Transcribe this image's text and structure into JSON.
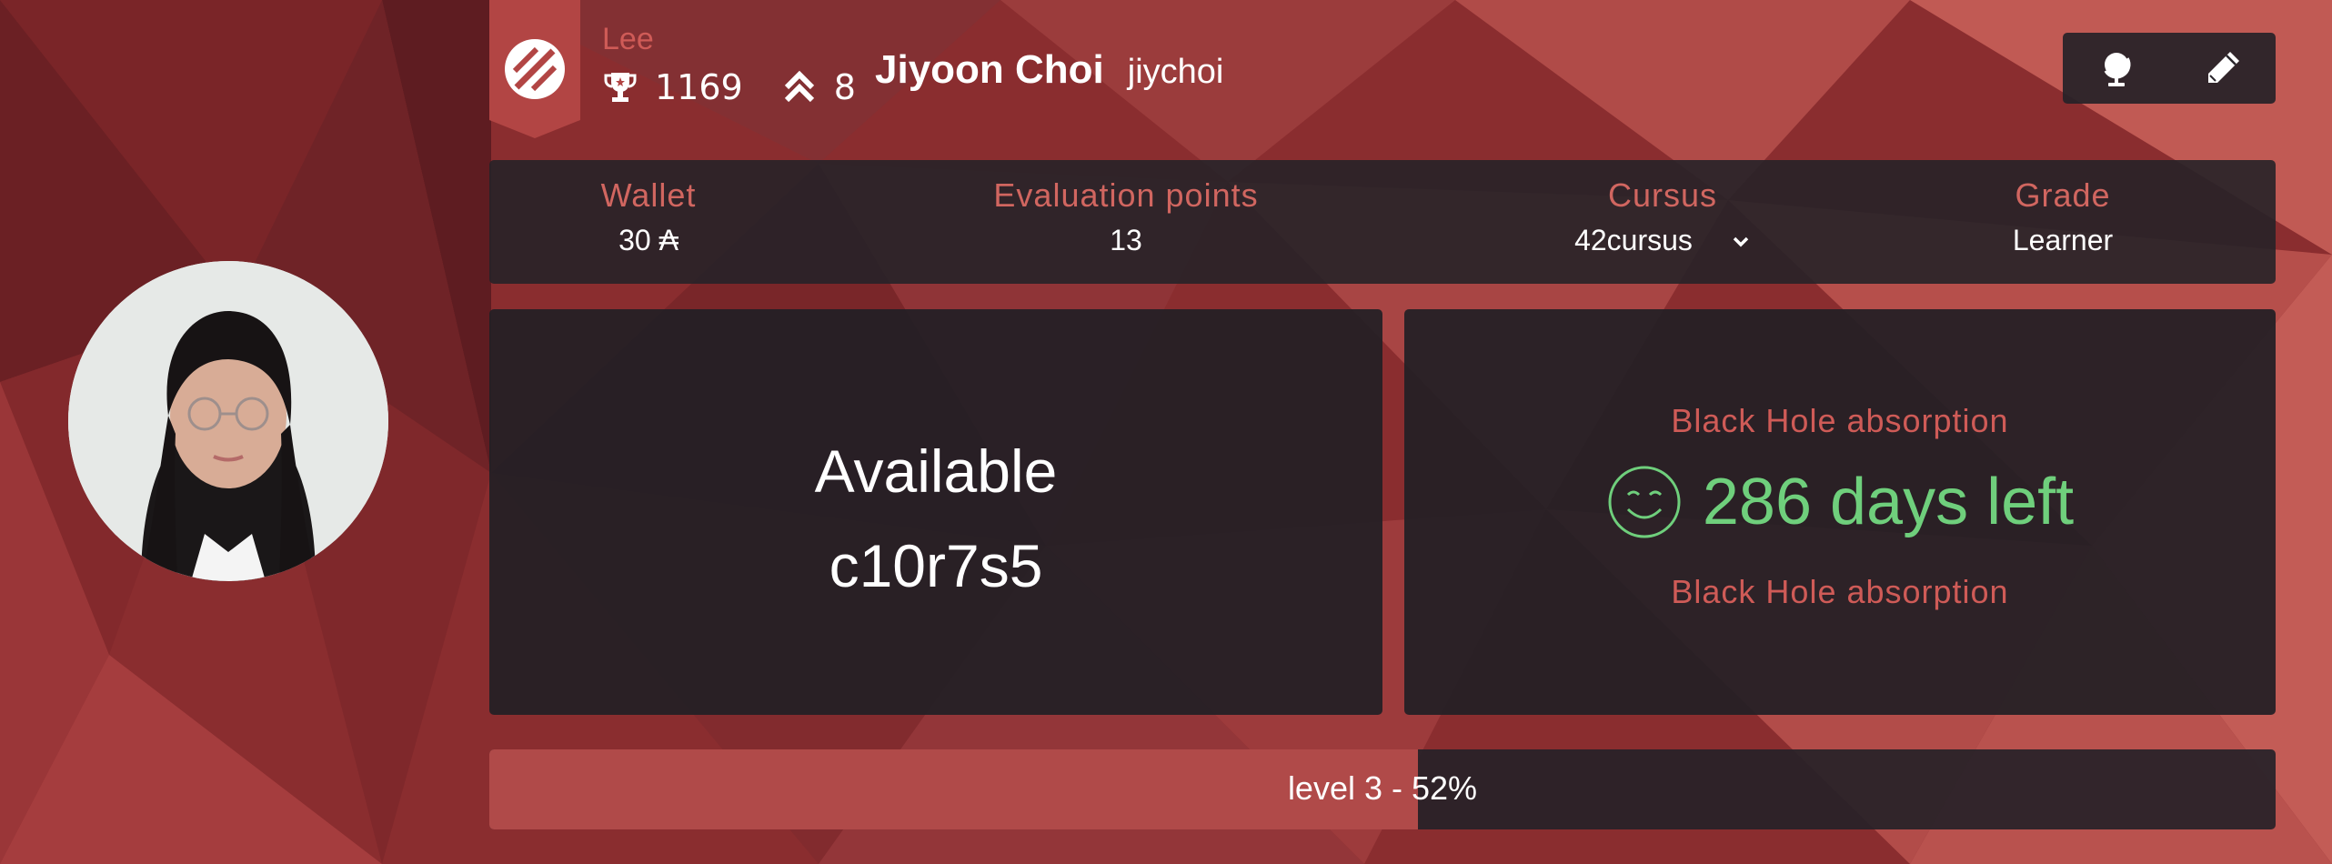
{
  "coalition": {
    "name": "Lee",
    "icon": "coalition-logo-icon",
    "color": "#b24544"
  },
  "stats": {
    "score": "1169",
    "rank": "8"
  },
  "user": {
    "full_name": "Jiyoon Choi",
    "login": "jiychoi"
  },
  "actions": [
    {
      "icon": "globe-icon"
    },
    {
      "icon": "pencil-icon"
    }
  ],
  "info": {
    "wallet_label": "Wallet",
    "wallet_value": "30 ₳",
    "eval_label": "Evaluation points",
    "eval_value": "13",
    "cursus_label": "Cursus",
    "cursus_value": "42cursus",
    "grade_label": "Grade",
    "grade_value": "Learner"
  },
  "location": {
    "status": "Available",
    "host": "c10r7s5"
  },
  "blackhole": {
    "label_top": "Black Hole absorption",
    "days": "286 days left",
    "label_bottom": "Black Hole absorption",
    "color": "#6fcf7c"
  },
  "level": {
    "text": "level 3 - 52%",
    "progress": 0.52
  }
}
